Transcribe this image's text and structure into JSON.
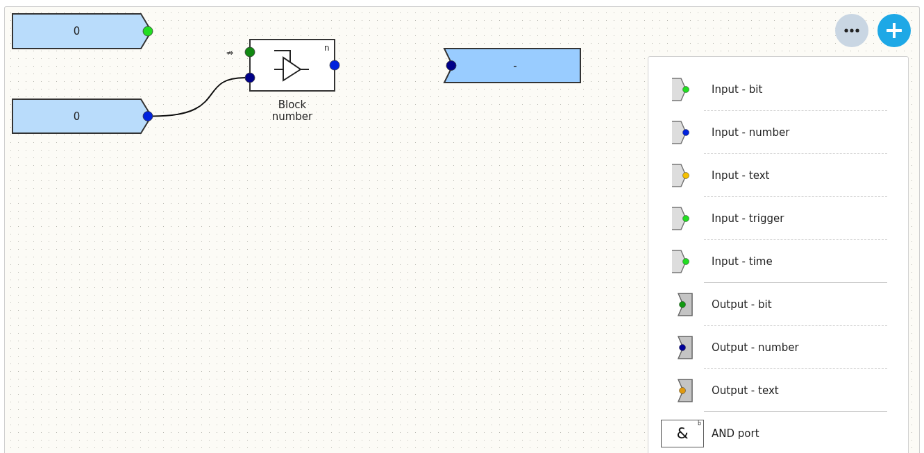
{
  "canvas": {
    "nodes": [
      {
        "kind": "input",
        "value": "0",
        "port": {
          "color": "#22dd22"
        }
      },
      {
        "kind": "input",
        "value": "0",
        "port": {
          "color": "#0022dd"
        }
      },
      {
        "kind": "block",
        "label": "Block number",
        "type_mark": "n",
        "trigger_symbol": "⇏",
        "ports": [
          {
            "kind": "input",
            "color": "#118811"
          },
          {
            "kind": "input",
            "color": "#000088"
          },
          {
            "kind": "output",
            "color": "#0022dd"
          }
        ]
      },
      {
        "kind": "output",
        "value": "-",
        "port": {
          "color": "#000088"
        }
      }
    ]
  },
  "palette": {
    "items": [
      {
        "kind": "input",
        "label": "Input - bit",
        "color": "#22dd22"
      },
      {
        "kind": "input",
        "label": "Input - number",
        "color": "#0022dd"
      },
      {
        "kind": "input",
        "label": "Input - text",
        "color": "#f5c000"
      },
      {
        "kind": "input",
        "label": "Input - trigger",
        "color": "#22dd22"
      },
      {
        "kind": "input",
        "label": "Input - time",
        "color": "#22dd22"
      },
      {
        "kind": "output",
        "label": "Output - bit",
        "color": "#119911"
      },
      {
        "kind": "output",
        "label": "Output - number",
        "color": "#000099"
      },
      {
        "kind": "output",
        "label": "Output - text",
        "color": "#e09a10"
      },
      {
        "kind": "gate",
        "label": "AND port",
        "symbol": "&",
        "corner_mark": "b"
      }
    ]
  }
}
